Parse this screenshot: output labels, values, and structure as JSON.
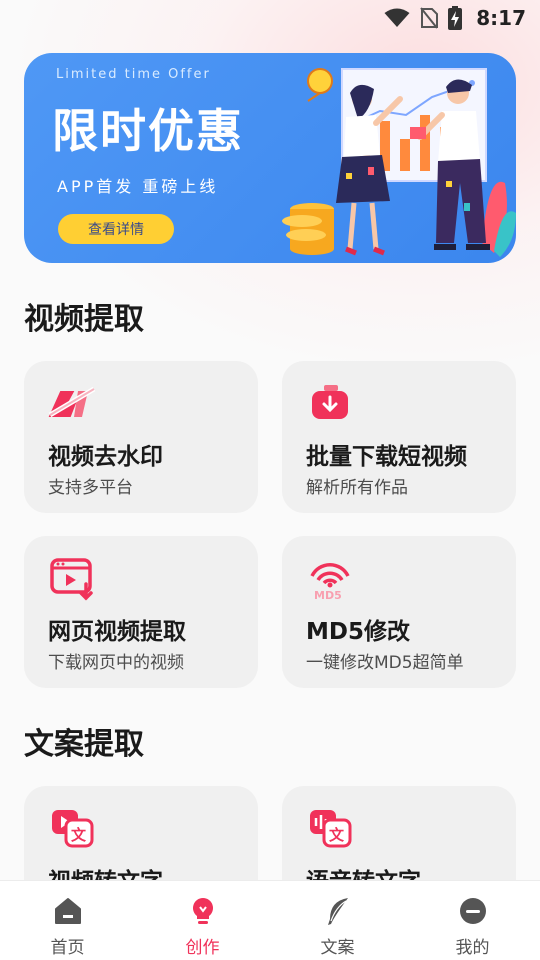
{
  "status_bar": {
    "time": "8:17"
  },
  "banner": {
    "subtitle": "Limited time Offer",
    "title": "限时优惠",
    "tagline": "APP首发  重磅上线",
    "button_label": "查看详情"
  },
  "sections": [
    {
      "title": "视频提取"
    },
    {
      "title": "文案提取"
    }
  ],
  "cards": [
    {
      "title": "视频去水印",
      "desc": "支持多平台",
      "icon": "watermark-remove-icon"
    },
    {
      "title": "批量下载短视频",
      "desc": "解析所有作品",
      "icon": "batch-download-icon"
    },
    {
      "title": "网页视频提取",
      "desc": "下载网页中的视频",
      "icon": "web-video-icon"
    },
    {
      "title": "MD5修改",
      "desc": "一键修改MD5超简单",
      "icon": "md5-signal-icon"
    },
    {
      "title": "视频转文字",
      "icon": "video-to-text-icon"
    },
    {
      "title": "语音转文字",
      "icon": "voice-to-text-icon"
    }
  ],
  "tabs": [
    {
      "label": "首页",
      "icon": "home-icon"
    },
    {
      "label": "创作",
      "icon": "lightbulb-icon",
      "active": true
    },
    {
      "label": "文案",
      "icon": "feather-icon"
    },
    {
      "label": "我的",
      "icon": "profile-icon"
    }
  ],
  "colors": {
    "accent": "#f0325a",
    "banner_blue": "#4690f2",
    "banner_button": "#ffcf33",
    "card_bg": "#f0f0f0"
  }
}
